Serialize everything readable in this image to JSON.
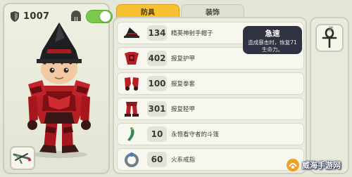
{
  "player": {
    "power": "1007",
    "show_helmet_toggle": true
  },
  "tabs": [
    {
      "label": "防具",
      "active": true
    },
    {
      "label": "装饰",
      "active": false
    }
  ],
  "items": [
    {
      "icon": "hat-icon",
      "value": "134",
      "name": "精英神射手帽子"
    },
    {
      "icon": "chest-armor-icon",
      "value": "402",
      "name": "报复护甲"
    },
    {
      "icon": "gauntlet-icon",
      "value": "100",
      "name": "报复拳套"
    },
    {
      "icon": "greaves-icon",
      "value": "301",
      "name": "报复胫甲"
    },
    {
      "icon": "cloak-icon",
      "value": "10",
      "name": "永恒看守者的斗篷"
    },
    {
      "icon": "ring-icon",
      "value": "60",
      "name": "火系戒指"
    }
  ],
  "tooltip": {
    "title": "急速",
    "line1": "造成暴击时，恢复71",
    "line2": "生命力。"
  },
  "right_slot": {
    "tag": "茅",
    "icon": "ankh-icon"
  },
  "watermark": {
    "text": "威海手游网"
  },
  "colors": {
    "accent_tab": "#f6c232",
    "toggle_on": "#7cc84a",
    "armor_red": "#b11c22",
    "tooltip_bg": "#2f3240"
  }
}
